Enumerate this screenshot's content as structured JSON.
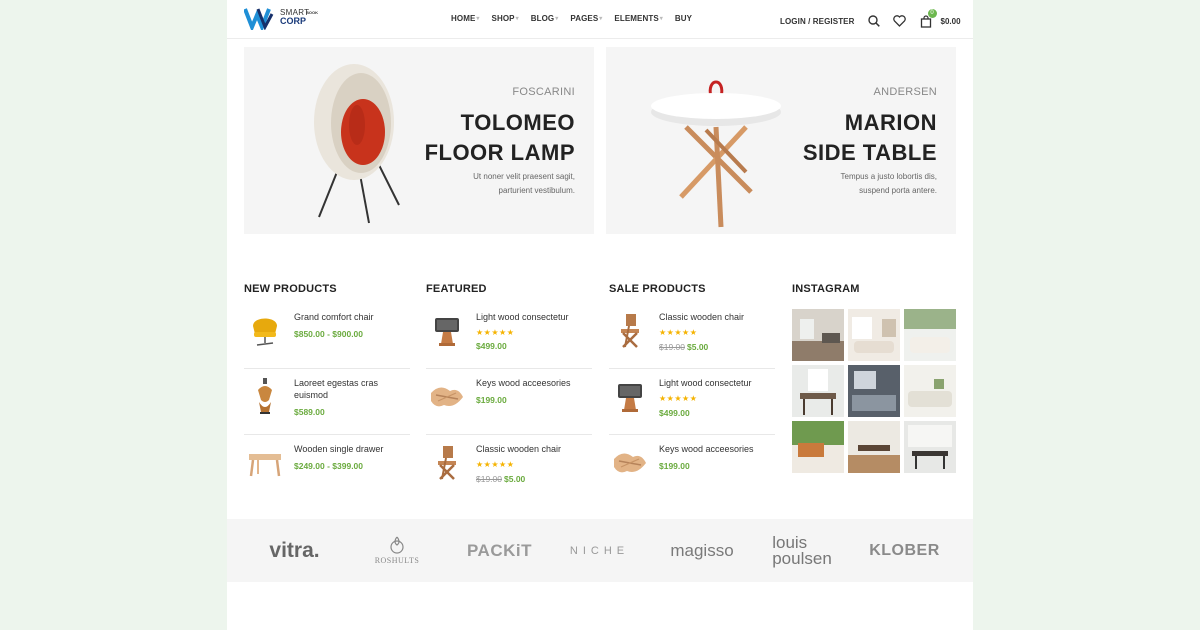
{
  "header": {
    "logo": {
      "line1": "SMART",
      "line2": "CORP",
      "tag": "BOOK"
    },
    "nav": [
      {
        "label": "HOME",
        "caret": "▾"
      },
      {
        "label": "SHOP",
        "caret": "▾"
      },
      {
        "label": "BLOG",
        "caret": "▾"
      },
      {
        "label": "PAGES",
        "caret": "▾"
      },
      {
        "label": "ELEMENTS",
        "caret": "▾"
      },
      {
        "label": "BUY",
        "caret": ""
      }
    ],
    "login": "LOGIN / REGISTER",
    "cart_count": "0",
    "cart_total": "$0.00"
  },
  "banners": [
    {
      "brand": "FOSCARINI",
      "title": "TOLOMEO\nFLOOR LAMP",
      "desc": "Ut noner velit praesent sagit,\nparturient vestibulum."
    },
    {
      "brand": "ANDERSEN",
      "title": "MARION\nSIDE TABLE",
      "desc": "Tempus a justo lobortis dis,\nsuspend porta antere."
    }
  ],
  "columns": {
    "new": {
      "title": "NEW PRODUCTS",
      "items": [
        {
          "name": "Grand comfort chair",
          "price": "$850.00 - $900.00",
          "icon": "yellow-chair"
        },
        {
          "name": "Laoreet egestas cras euismod",
          "price": "$589.00",
          "icon": "lamp"
        },
        {
          "name": "Wooden single drawer",
          "price": "$249.00 - $399.00",
          "icon": "wood-stool"
        }
      ]
    },
    "featured": {
      "title": "FEATURED",
      "items": [
        {
          "name": "Light wood consectetur",
          "stars": "★★★★★",
          "price": "$499.00",
          "icon": "wood-lamp"
        },
        {
          "name": "Keys wood acceesories",
          "price": "$199.00",
          "icon": "key-holder"
        },
        {
          "name": "Classic wooden chair",
          "stars": "★★★★★",
          "old_price": "$19.00",
          "price": "$5.00",
          "icon": "folding-chair"
        }
      ]
    },
    "sale": {
      "title": "SALE PRODUCTS",
      "items": [
        {
          "name": "Classic wooden chair",
          "stars": "★★★★★",
          "old_price": "$19.00",
          "price": "$5.00",
          "icon": "folding-chair"
        },
        {
          "name": "Light wood consectetur",
          "stars": "★★★★★",
          "price": "$499.00",
          "icon": "wood-lamp"
        },
        {
          "name": "Keys wood acceesories",
          "price": "$199.00",
          "icon": "key-holder"
        }
      ]
    },
    "instagram": {
      "title": "INSTAGRAM"
    }
  },
  "brands": [
    "vitra.",
    "ROSHULTS",
    "PACKiT",
    "NICHE",
    "magisso",
    "louis\npoulsen",
    "KLOBER"
  ],
  "colors": {
    "accent": "#6bab3f",
    "star": "#f5b301",
    "logo_blue": "#1f8fd6"
  }
}
